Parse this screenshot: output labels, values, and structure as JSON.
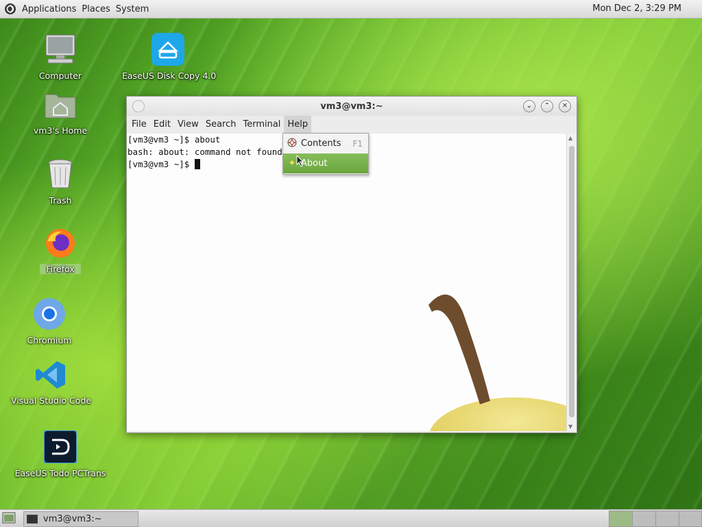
{
  "top_panel": {
    "menus": [
      "Applications",
      "Places",
      "System"
    ],
    "clock": "Mon Dec  2,  3:29 PM"
  },
  "desktop_icons": [
    {
      "name": "computer",
      "label": "Computer"
    },
    {
      "name": "easeus-disk-copy",
      "label": "EaseUS Disk Copy 4.0"
    },
    {
      "name": "home",
      "label": "vm3's Home"
    },
    {
      "name": "trash",
      "label": "Trash"
    },
    {
      "name": "firefox",
      "label": "Firefox"
    },
    {
      "name": "chromium",
      "label": "Chromium"
    },
    {
      "name": "vscode",
      "label": "Visual Studio Code"
    },
    {
      "name": "easeus-todo-pctrans",
      "label": "EaseUS Todo PCTrans"
    }
  ],
  "terminal": {
    "title": "vm3@vm3:~",
    "menus": [
      "File",
      "Edit",
      "View",
      "Search",
      "Terminal",
      "Help"
    ],
    "lines": [
      "[vm3@vm3 ~]$ about",
      "bash: about: command not found",
      "[vm3@vm3 ~]$ "
    ]
  },
  "help_menu": {
    "items": [
      {
        "label": "Contents",
        "accel": "F1",
        "icon": "help-lifebuoy-icon"
      },
      {
        "label": "About",
        "accel": "",
        "icon": "about-star-icon"
      }
    ]
  },
  "taskbar": {
    "window_button": "vm3@vm3:~",
    "workspaces": 4
  },
  "colors": {
    "menu_highlight": "#77b049",
    "terminal_bg": "#fdfdfd"
  }
}
